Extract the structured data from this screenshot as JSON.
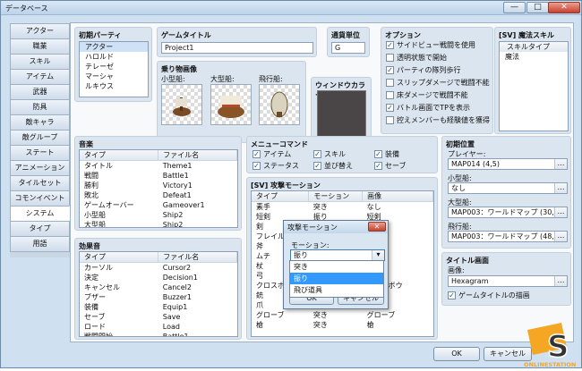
{
  "window": {
    "title": "データベース",
    "controls": {
      "minimize": "—",
      "maximize": "□",
      "close": "✕"
    }
  },
  "tabs": [
    "アクター",
    "職業",
    "スキル",
    "アイテム",
    "武器",
    "防具",
    "敵キャラ",
    "敵グループ",
    "ステート",
    "アニメーション",
    "タイルセット",
    "コモンイベント",
    "システム",
    "タイプ",
    "用語"
  ],
  "selected_tab": "システム",
  "party": {
    "heading": "初期パーティ",
    "members": [
      "アクター",
      "ハロルド",
      "テレーゼ",
      "マーシャ",
      "ルキウス"
    ]
  },
  "game_title": {
    "heading": "ゲームタイトル",
    "value": "Project1"
  },
  "currency": {
    "heading": "通貨単位",
    "value": "G"
  },
  "vehicle_images": {
    "heading": "乗り物画像",
    "labels": [
      "小型船:",
      "大型船:",
      "飛行船:"
    ]
  },
  "window_color": {
    "heading": "ウィンドウカラー",
    "color": "#4a4648"
  },
  "options": {
    "heading": "オプション",
    "items": [
      {
        "label": "サイドビュー戦闘を使用",
        "checked": true
      },
      {
        "label": "透明状態で開始",
        "checked": false
      },
      {
        "label": "パーティの隊列歩行",
        "checked": true
      },
      {
        "label": "スリップダメージで戦闘不能",
        "checked": false
      },
      {
        "label": "床ダメージで戦闘不能",
        "checked": false
      },
      {
        "label": "バトル画面でTPを表示",
        "checked": true
      },
      {
        "label": "控えメンバーも経験値を獲得",
        "checked": false
      }
    ]
  },
  "magic_skills": {
    "heading": "[SV] 魔法スキル",
    "column": "スキルタイプ",
    "rows": [
      "魔法"
    ]
  },
  "music": {
    "heading": "音楽",
    "columns": [
      "タイプ",
      "ファイル名"
    ],
    "rows": [
      [
        "タイトル",
        "Theme1"
      ],
      [
        "戦闘",
        "Battle1"
      ],
      [
        "勝利",
        "Victory1"
      ],
      [
        "敗北",
        "Defeat1"
      ],
      [
        "ゲームオーバー",
        "Gameover1"
      ],
      [
        "小型船",
        "Ship2"
      ],
      [
        "大型船",
        "Ship2"
      ],
      [
        "飛行船",
        "Ship1"
      ]
    ]
  },
  "sounds": {
    "heading": "効果音",
    "columns": [
      "タイプ",
      "ファイル名"
    ],
    "rows": [
      [
        "カーソル",
        "Cursor2"
      ],
      [
        "決定",
        "Decision1"
      ],
      [
        "キャンセル",
        "Cancel2"
      ],
      [
        "ブザー",
        "Buzzer1"
      ],
      [
        "装備",
        "Equip1"
      ],
      [
        "セーブ",
        "Save"
      ],
      [
        "ロード",
        "Load"
      ],
      [
        "戦闘開始",
        "Battle1"
      ]
    ]
  },
  "menu_commands": {
    "heading": "メニューコマンド",
    "items": [
      {
        "label": "アイテム",
        "checked": true
      },
      {
        "label": "スキル",
        "checked": true
      },
      {
        "label": "装備",
        "checked": true
      },
      {
        "label": "ステータス",
        "checked": true
      },
      {
        "label": "並び替え",
        "checked": true
      },
      {
        "label": "セーブ",
        "checked": true
      }
    ]
  },
  "attack_motions": {
    "heading": "[SV] 攻撃モーション",
    "columns": [
      "タイプ",
      "モーション",
      "画像"
    ],
    "rows": [
      [
        "素手",
        "突き",
        "なし"
      ],
      [
        "短剣",
        "振り",
        "短剣"
      ],
      [
        "剣",
        "",
        "剣"
      ],
      [
        "フレイル",
        "",
        ""
      ],
      [
        "斧",
        "",
        ""
      ],
      [
        "ムチ",
        "",
        ""
      ],
      [
        "杖",
        "",
        ""
      ],
      [
        "弓",
        "",
        ""
      ],
      [
        "クロスボウ",
        "",
        "クロスボウ"
      ],
      [
        "銃",
        "",
        ""
      ],
      [
        "爪",
        "",
        ""
      ],
      [
        "グローブ",
        "突き",
        "グローブ"
      ],
      [
        "槍",
        "突き",
        "槍"
      ]
    ]
  },
  "start_position": {
    "heading": "初期位置",
    "rows": [
      {
        "label": "プレイヤー:",
        "value": "MAP014 (4,5)"
      },
      {
        "label": "小型船:",
        "value": "なし"
      },
      {
        "label": "大型船:",
        "value": "MAP003：ワールドマップ (30,48)"
      },
      {
        "label": "飛行船:",
        "value": "MAP003：ワールドマップ (48,11)"
      }
    ],
    "button": "…"
  },
  "title_screen": {
    "heading": "タイトル画面",
    "image_label": "画像:",
    "image_value": "Hexagram",
    "draw_title": {
      "label": "ゲームタイトルの描画",
      "checked": true
    }
  },
  "dialog": {
    "title": "攻撃モーション",
    "close": "✕",
    "motion_label": "モーション:",
    "motion_value": "振り",
    "options": [
      "突き",
      "振り",
      "飛び道具"
    ],
    "highlighted": "振り",
    "ok": "OK",
    "cancel": "キャンセル"
  },
  "footer": {
    "ok": "OK",
    "cancel": "キャンセル"
  },
  "watermark": {
    "letter": "S",
    "text": "ONLINESTATION"
  }
}
